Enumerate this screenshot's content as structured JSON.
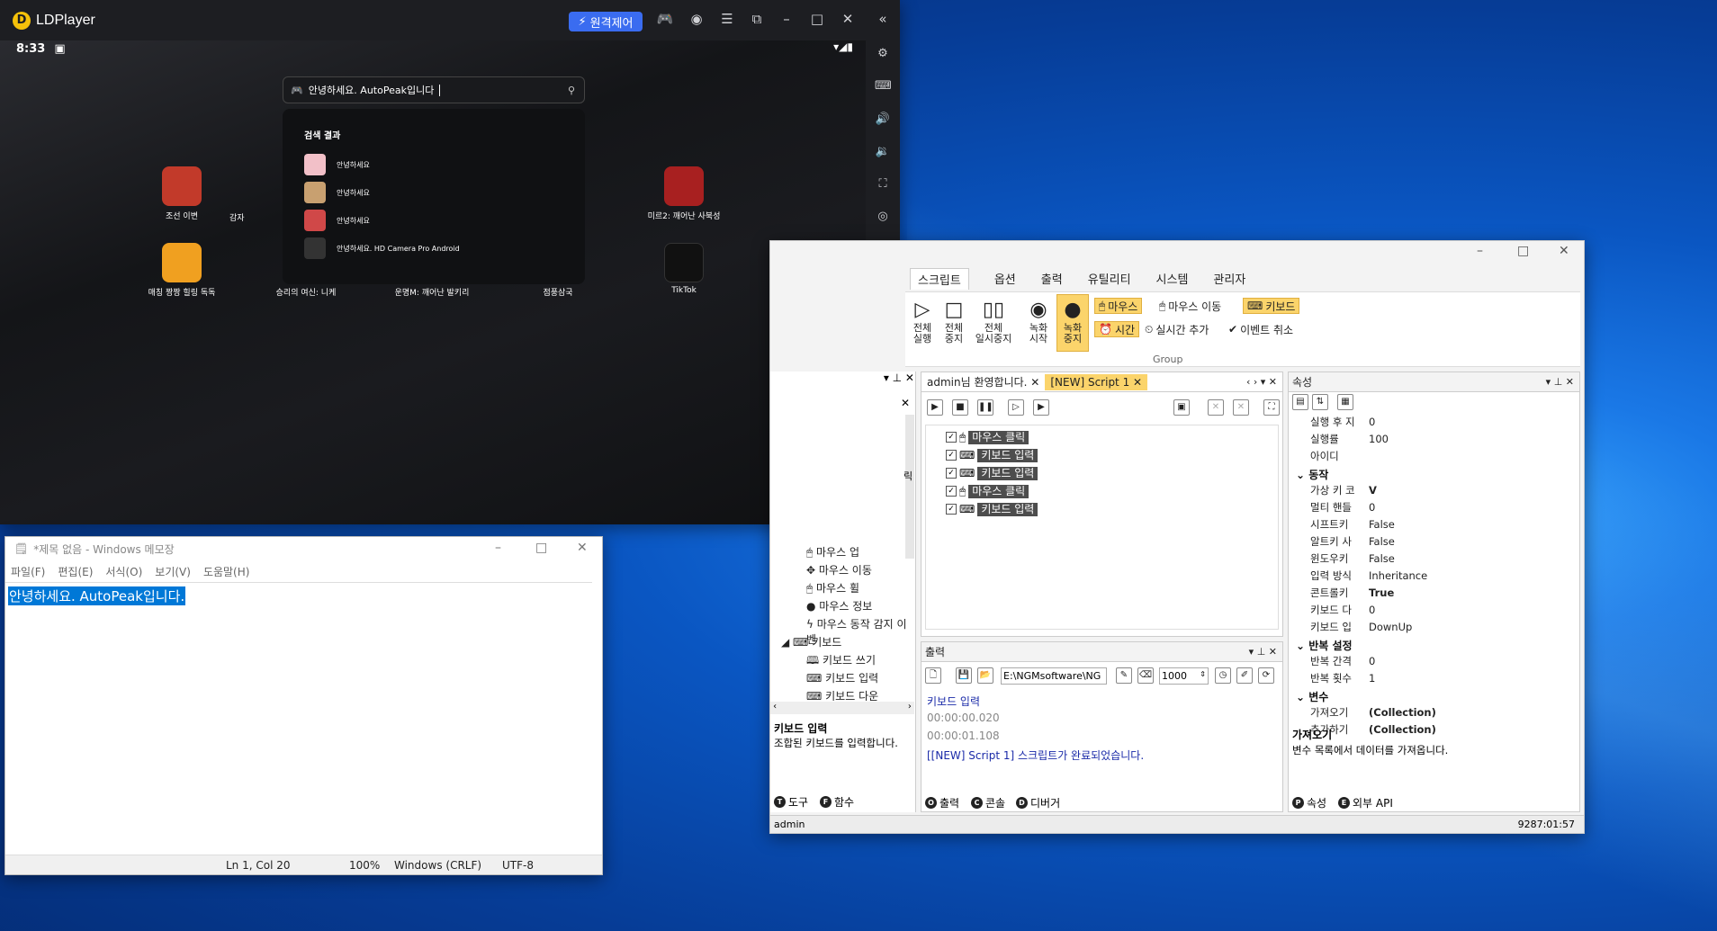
{
  "ldplayer": {
    "title": "LDPlayer",
    "remote": "원격제어",
    "time": "8:33",
    "search": {
      "value": "안녕하세요. AutoPeak입니다"
    },
    "results": {
      "heading": "검색 결과",
      "items": [
        "안녕하세요",
        "안녕하세요",
        "안녕하세요",
        "안녕하세요. HD Camera Pro Android"
      ]
    },
    "apps": [
      "조선 이변",
      "감자",
      "미르2: 깨어난 사북성",
      "매칭 짱짱 힐링 독독",
      "승리의 여신: 니케",
      "운명M: 깨어난 발키리",
      "점풍삼국",
      "TikTok"
    ],
    "icon_colors": [
      "#c23a2a",
      "#e08a20",
      "#a82020",
      "#f0a020",
      "#3a3a3a",
      "#505050",
      "#404040",
      "#111111"
    ]
  },
  "notepad": {
    "title": "*제목 없음 - Windows 메모장",
    "menu": [
      "파일(F)",
      "편집(E)",
      "서식(O)",
      "보기(V)",
      "도움말(H)"
    ],
    "text": "안녕하세요. AutoPeak입니다.",
    "status": {
      "pos": "Ln 1, Col 20",
      "zoom": "100%",
      "eol": "Windows (CRLF)",
      "enc": "UTF-8"
    }
  },
  "autopeak": {
    "tabs": [
      "스크립트",
      "옵션",
      "출력",
      "유틸리티",
      "시스템",
      "관리자"
    ],
    "ribbon": {
      "run_all": "전체\n실행",
      "stop_all": "전체\n중지",
      "pause_all": "전체\n일시중지",
      "rec_start": "녹화\n시작",
      "rec_stop": "녹화\n중지",
      "mouse": "마우스",
      "mouse_move": "마우스 이동",
      "keyboard": "키보드",
      "time": "시간",
      "realtime": "실시간 추가",
      "event_cancel": "이벤트 취소",
      "group": "Group"
    },
    "doc_tabs": [
      "admin님 환영합니다.",
      "[NEW] Script 1"
    ],
    "script_rows": [
      "마우스 클릭",
      "키보드 입력",
      "키보드 입력",
      "마우스 클릭",
      "키보드 입력"
    ],
    "tree": [
      "마우스 업",
      "마우스 이동",
      "마우스 휠",
      "마우스 정보",
      "마우스 동작 감지 이벤",
      "키보드",
      "키보드 쓰기",
      "키보드 입력",
      "키보드 다운"
    ],
    "tree_frag": "릭",
    "tool_desc": {
      "title": "키보드 입력",
      "text": "조합된 키보드를 입력합니다."
    },
    "output": {
      "title": "출력",
      "path": "E:\\NGMsoftware\\NG",
      "num": "1000",
      "lines": [
        "키보드 입력",
        "00:00:00.020",
        "00:00:01.108",
        "[[NEW] Script 1] 스크립트가 완료되었습니다."
      ]
    },
    "props": {
      "title": "속성",
      "rows": [
        [
          "실행 후 지",
          "0"
        ],
        [
          "실행률",
          "100"
        ],
        [
          "아이디",
          ""
        ]
      ],
      "g1": "동작",
      "rows2": [
        [
          "가상 키 코",
          "V"
        ],
        [
          "멀티 핸들",
          "0"
        ],
        [
          "시프트키",
          "False"
        ],
        [
          "알트키 사",
          "False"
        ],
        [
          "윈도우키",
          "False"
        ],
        [
          "입력 방식",
          "Inheritance"
        ],
        [
          "콘트롤키",
          "True"
        ],
        [
          "키보드 다",
          "0"
        ],
        [
          "키보드 입",
          "DownUp"
        ]
      ],
      "g2": "반복 설정",
      "rows3": [
        [
          "반복 간격",
          "0"
        ],
        [
          "반복 횟수",
          "1"
        ]
      ],
      "g3": "변수",
      "rows4": [
        [
          "가져오기",
          "(Collection)"
        ],
        [
          "추가하기",
          "(Collection)"
        ]
      ],
      "desc_title": "가져오기",
      "desc": "변수 목록에서 데이터를 가져옵니다."
    },
    "bottom_tabs": [
      "도구",
      "함수",
      "출력",
      "콘솔",
      "디버거",
      "속성",
      "외부 API"
    ],
    "status_left": "admin",
    "status_right": "9287:01:57"
  }
}
